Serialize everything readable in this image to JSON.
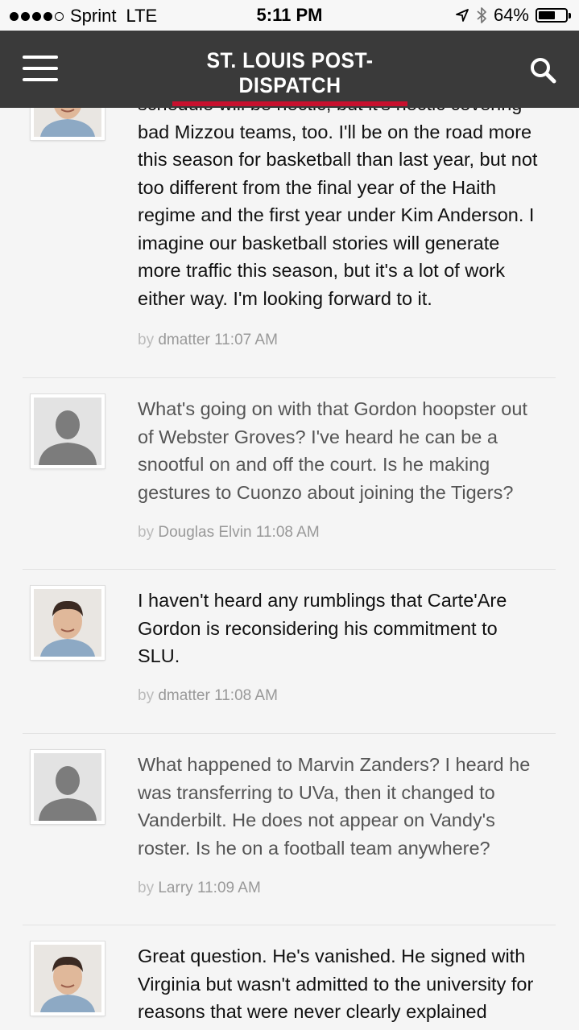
{
  "status_bar": {
    "carrier": "Sprint",
    "network": "LTE",
    "time": "5:11 PM",
    "battery": "64%",
    "battery_level": 0.64
  },
  "header": {
    "logo_text": "ST. LOUIS POST-DISPATCH",
    "brand_color": "#c8102e",
    "menu_icon": "hamburger-menu-icon",
    "search_icon": "search-icon"
  },
  "posts": [
    {
      "avatar": "author-photo",
      "type": "answer",
      "text": "schedule will be hectic, but it's hectic covering bad Mizzou teams, too. I'll be on the road more this season for basketball than last year, but not too different from the final year of the Haith regime and the first year under Kim Anderson. I imagine our basketball stories will generate more traffic this season, but it's a lot of work either way. I'm looking forward to it.",
      "by": "by",
      "author": "dmatter",
      "time": "11:07 AM"
    },
    {
      "avatar": "generic",
      "type": "question",
      "text": "What's going on with that Gordon hoopster out of Webster Groves? I've heard he can be a snootful on and off the court. Is he making gestures to Cuonzo about joining the Tigers?",
      "by": "by",
      "author": "Douglas Elvin",
      "time": "11:08 AM"
    },
    {
      "avatar": "author-photo",
      "type": "answer",
      "text": "I haven't heard any rumblings that Carte'Are Gordon is reconsidering his commitment to SLU.",
      "by": "by",
      "author": "dmatter",
      "time": "11:08 AM"
    },
    {
      "avatar": "generic",
      "type": "question",
      "text": "What happened to Marvin Zanders? I heard he was transferring to UVa, then it changed to Vanderbilt. He does not appear on Vandy's roster. Is he on a football team anywhere?",
      "by": "by",
      "author": "Larry",
      "time": "11:09 AM"
    },
    {
      "avatar": "author-photo",
      "type": "answer",
      "text": "Great question. He's vanished. He signed with Virginia but wasn't admitted to the university for reasons that were never clearly explained",
      "by": "",
      "author": "",
      "time": ""
    }
  ]
}
